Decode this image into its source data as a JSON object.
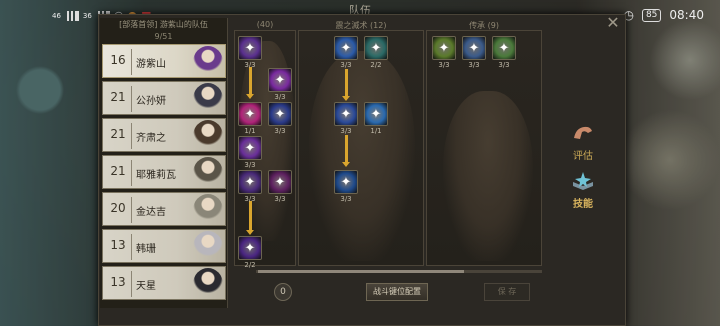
{
  "status_bar": {
    "signal_1": "46",
    "signal_2": "36",
    "battery": "85",
    "time": "08:40"
  },
  "window_title": "队伍",
  "party": {
    "header": "[部落首领] 游紫山的队伍",
    "count": "9/51",
    "members": [
      {
        "level": "16",
        "name": "游紫山",
        "active": true,
        "color": "#6a3b8c"
      },
      {
        "level": "21",
        "name": "公孙妍",
        "active": false,
        "color": "#3a3a48"
      },
      {
        "level": "21",
        "name": "齐肃之",
        "active": false,
        "color": "#4a3a2c"
      },
      {
        "level": "21",
        "name": "耶雅莉瓦",
        "active": false,
        "color": "#5a5448"
      },
      {
        "level": "20",
        "name": "金达吉",
        "active": false,
        "color": "#8a8678"
      },
      {
        "level": "13",
        "name": "韩珊",
        "active": false,
        "color": "#b8b6bc"
      },
      {
        "level": "13",
        "name": "天星",
        "active": false,
        "color": "#2a2a30"
      }
    ]
  },
  "panels": {
    "left": {
      "title": "(40)"
    },
    "middle": {
      "title": "震之滅术 (12)"
    },
    "right": {
      "title": "传承 (9)"
    }
  },
  "skills": {
    "left": [
      {
        "count": "3/3",
        "color": "#5a2f8f",
        "icon": "void-icon"
      },
      {
        "count": "3/3",
        "color": "#7a2aa0",
        "icon": "vortex-icon"
      },
      {
        "count": "1/1",
        "color": "#b2237a",
        "icon": "burst-icon"
      },
      {
        "count": "3/3",
        "color": "#2a3a8a",
        "icon": "arcane-icon"
      },
      {
        "count": "3/3",
        "color": "#6a2e9a",
        "icon": "skull-icon"
      },
      {
        "count": "3/3",
        "color": "#4a2a7a",
        "icon": "tentacle-icon"
      },
      {
        "count": "3/3",
        "color": "#5e2060",
        "icon": "flame-icon"
      },
      {
        "count": "2/2",
        "color": "#4a2582",
        "icon": "shadow-icon"
      }
    ],
    "middle": [
      {
        "count": "3/3",
        "color": "#2a5aa8",
        "icon": "wind-icon"
      },
      {
        "count": "2/2",
        "color": "#2a6a66",
        "icon": "shuriken-icon"
      },
      {
        "count": "3/3",
        "color": "#2a4a9a",
        "icon": "spiral-icon"
      },
      {
        "count": "1/1",
        "color": "#2a6ab0",
        "icon": "figure-icon"
      },
      {
        "count": "3/3",
        "color": "#1e4a8c",
        "icon": "dash-icon"
      }
    ],
    "right": [
      {
        "count": "3/3",
        "color": "#5a7a2a",
        "icon": "leaf-icon"
      },
      {
        "count": "3/3",
        "color": "#3a5a8a",
        "icon": "arrow-icon"
      },
      {
        "count": "3/3",
        "color": "#4a7a3a",
        "icon": "blade-icon"
      }
    ]
  },
  "bottom": {
    "counter": "0",
    "config_button": "战斗键位配置",
    "save_button": "保 存"
  },
  "side_tabs": {
    "character": "评估",
    "skills": "技能"
  }
}
